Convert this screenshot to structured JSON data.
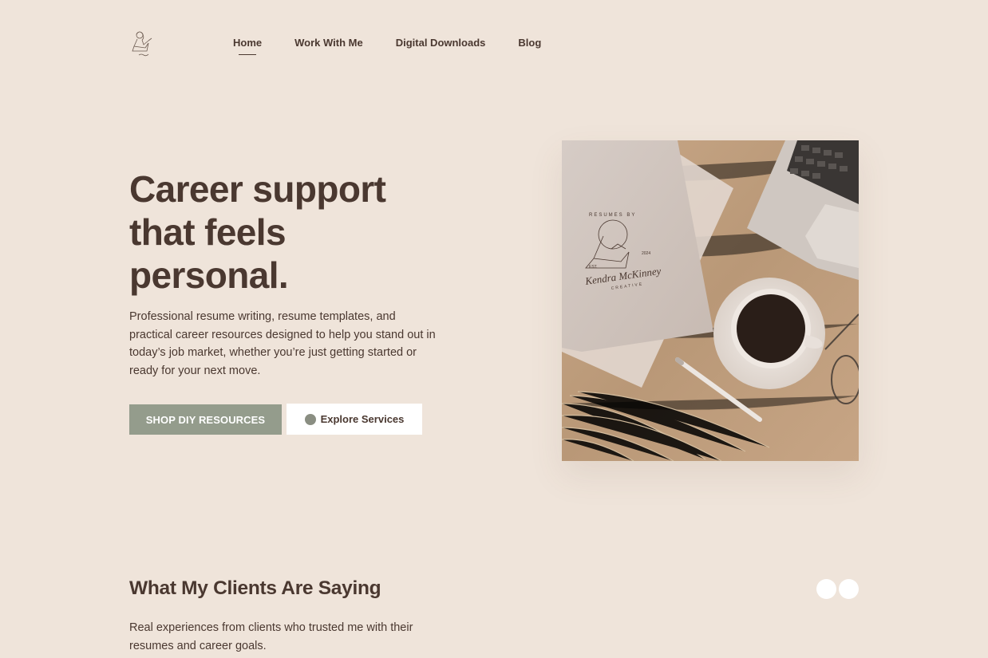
{
  "nav": {
    "logo_icon": "illustrated-woman-logo",
    "items": [
      {
        "label": "Home",
        "active": true
      },
      {
        "label": "Work With Me"
      },
      {
        "label": "Digital Downloads"
      },
      {
        "label": "Blog"
      }
    ]
  },
  "hero": {
    "title": "Career support that feels personal.",
    "description": "Professional resume writing, resume templates, and practical career resources designed to help you stand out in today’s job market, whether you’re just getting started or ready for your next move.",
    "primary_button": "SHOP DIY RESOURCES",
    "secondary_button": "Explore Services",
    "secondary_icon": "circle-dot-icon",
    "image": {
      "scene": "desk-flatlay-with-notebook-coffee-laptop",
      "brand_top": "RESUMES BY",
      "brand_left": "EST.",
      "brand_right": "2024",
      "brand_script": "Kendra McKinney",
      "brand_bottom": "CREATIVE"
    }
  },
  "testimonials": {
    "title": "What My Clients Are Saying",
    "description": "Real experiences from clients who trusted me with their resumes and career goals.",
    "prev_icon": "chevron-left-icon",
    "next_icon": "chevron-right-icon"
  },
  "colors": {
    "background": "#efe4da",
    "text": "#4a3830",
    "accent_sage": "#949c8c",
    "white": "#ffffff"
  }
}
